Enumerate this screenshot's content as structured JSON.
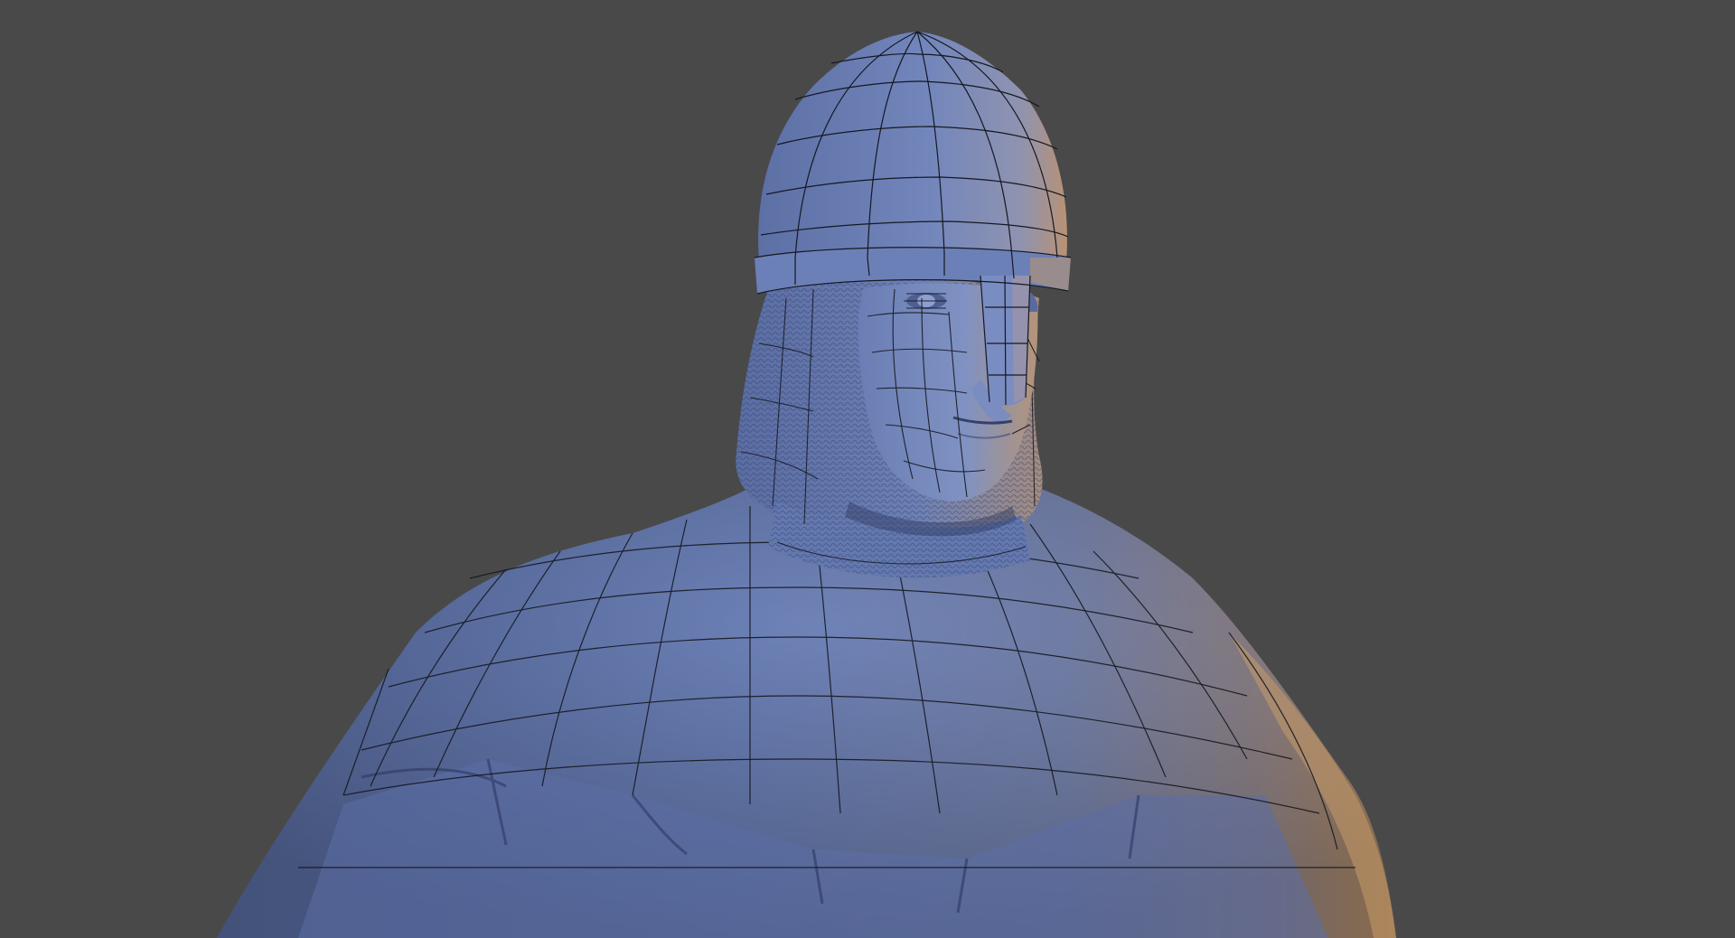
{
  "viewport": {
    "background_color": "#494949",
    "subject": "knight-bust-wireframe",
    "colors": {
      "mesh_base": "#6a7fb6",
      "mesh_shadow": "#3c4b78",
      "mesh_highlight": "#8ea0d0",
      "rim_light": "#c79a6a",
      "wire": "#15181f"
    }
  }
}
